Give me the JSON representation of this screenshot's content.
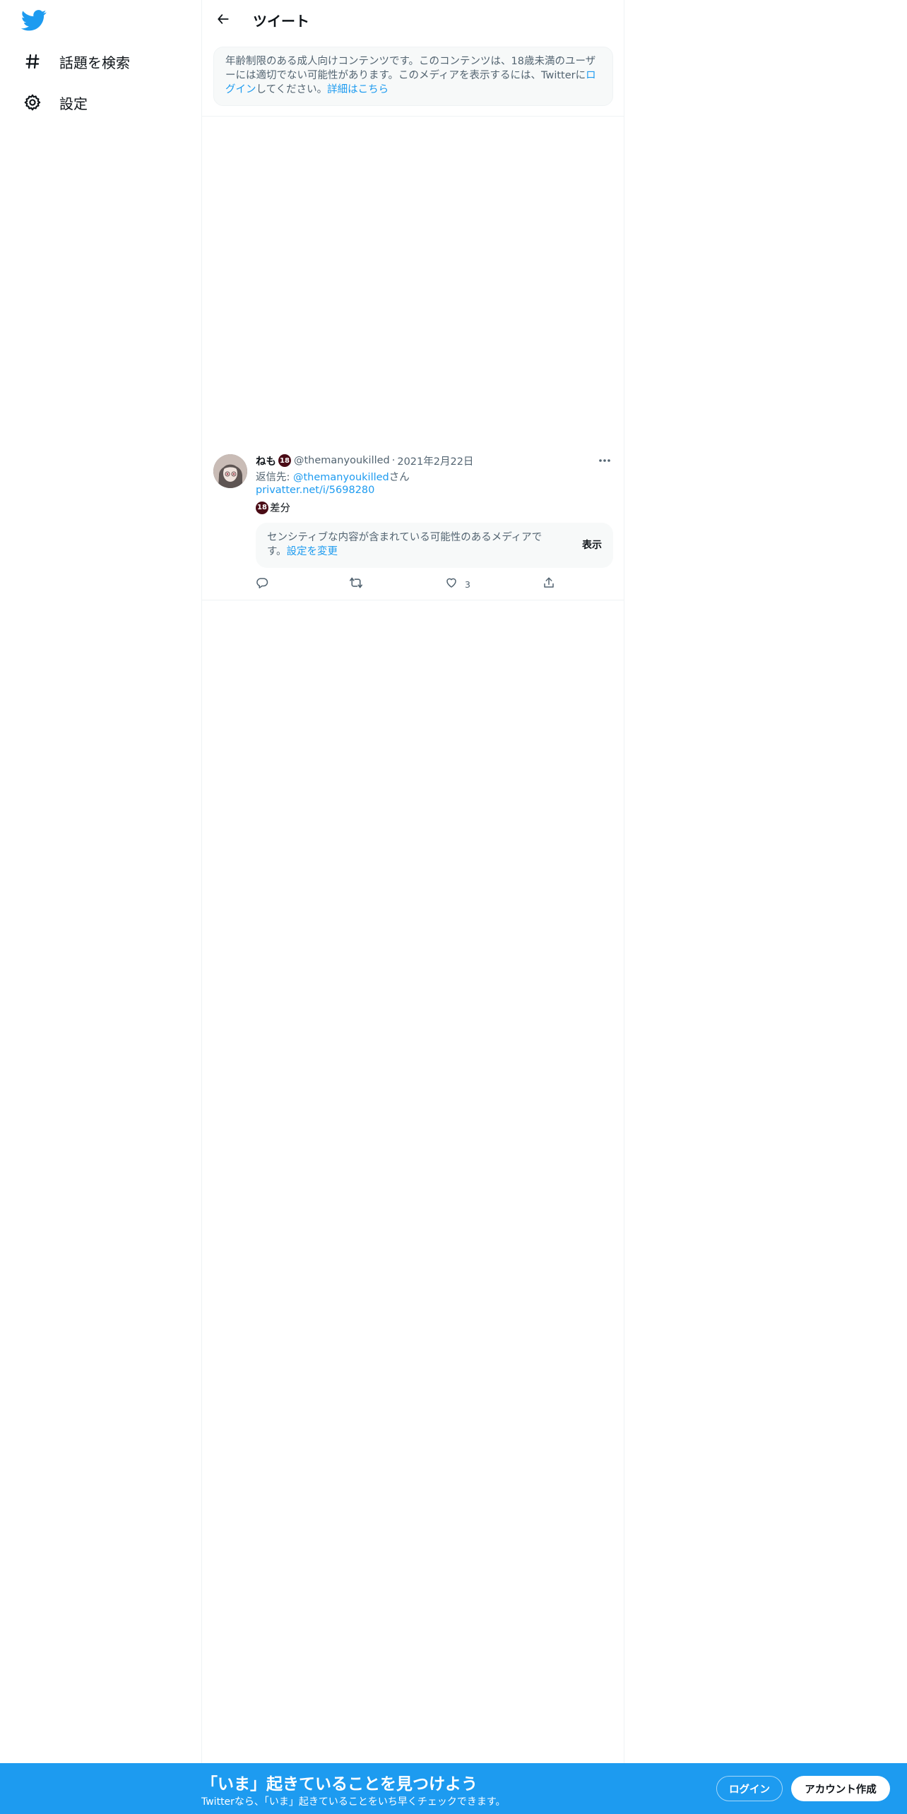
{
  "colors": {
    "accent": "#1d9bf0",
    "badge": "#4a0c16",
    "muted": "#536471",
    "text": "#0f1419"
  },
  "sidebar": {
    "logo_icon": "twitter-bird-icon",
    "items": [
      {
        "label": "話題を検索",
        "icon": "hashtag-icon"
      },
      {
        "label": "設定",
        "icon": "gear-icon"
      }
    ]
  },
  "header": {
    "title": "ツイート",
    "back_icon": "arrow-left-icon"
  },
  "notice": {
    "text_1": "年齢制限のある成人向けコンテンツです。このコンテンツは、18歳未満のユーザーには適切でない可能性があります。このメディアを表示するには、Twitterに",
    "login_link": "ログイン",
    "text_2": "してください。",
    "learn_more": "詳細はこちら"
  },
  "tweet": {
    "name": "ねも",
    "name_badge": "18",
    "handle": "@themanyoukilled",
    "separator": "·",
    "date": "2021年2月22日",
    "reply_prefix": "返信先: ",
    "reply_handle": "@themanyoukilled",
    "reply_suffix": "さん",
    "link": "privatter.net/i/5698280",
    "body_badge": "18",
    "body_text": "差分",
    "sensitive_text": "センシティブな内容が含まれている可能性のあるメディアです。",
    "sensitive_link": "設定を変更",
    "show_label": "表示",
    "actions": {
      "reply_icon": "reply-icon",
      "retweet_icon": "retweet-icon",
      "like_icon": "heart-icon",
      "like_count": "3",
      "share_icon": "share-icon"
    }
  },
  "banner": {
    "title": "「いま」起きていることを見つけよう",
    "subtitle": "Twitterなら、「いま」起きていることをいち早くチェックできます。",
    "login": "ログイン",
    "signup": "アカウント作成"
  }
}
